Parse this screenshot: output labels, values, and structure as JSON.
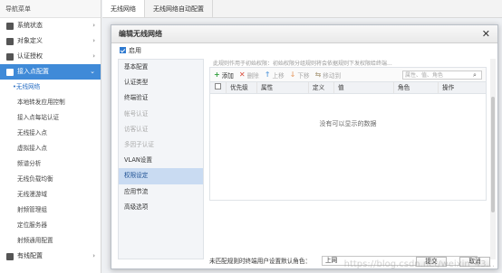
{
  "nav": {
    "title": "导航菜单",
    "groups_top": [
      {
        "label": "系统状态"
      },
      {
        "label": "对象定义"
      },
      {
        "label": "认证授权"
      }
    ],
    "active_group": {
      "label": "接入点配置"
    },
    "sub_items": [
      {
        "label": "•无线网络"
      },
      {
        "label": "本地转发应用控制"
      },
      {
        "label": "接入点每站认证"
      },
      {
        "label": "无线接入点"
      },
      {
        "label": "虚拟接入点"
      },
      {
        "label": "频谱分析"
      },
      {
        "label": "无线负载均衡"
      },
      {
        "label": "无线漫游域"
      },
      {
        "label": "射频管理组"
      },
      {
        "label": "定位服务器"
      },
      {
        "label": "射频通用配置"
      }
    ],
    "bottom_group": {
      "label": "有线配置"
    }
  },
  "tabs": [
    {
      "label": "无线网络"
    },
    {
      "label": "无线网络自动配置"
    }
  ],
  "dialog": {
    "title": "编辑无线网络",
    "close_glyph": "✕",
    "enable_label": "启用",
    "side_items": [
      {
        "label": "基本配置",
        "state": "normal"
      },
      {
        "label": "认证类型",
        "state": "normal"
      },
      {
        "label": "终端验证",
        "state": "normal"
      },
      {
        "label": "帐号认证",
        "state": "disabled"
      },
      {
        "label": "访客认证",
        "state": "disabled"
      },
      {
        "label": "多因子认证",
        "state": "disabled"
      },
      {
        "label": "VLAN设置",
        "state": "normal"
      },
      {
        "label": "权限设定",
        "state": "current"
      },
      {
        "label": "应用节流",
        "state": "normal"
      },
      {
        "label": "高级选项",
        "state": "normal"
      }
    ],
    "hint": "此规则作用于初始权限：初始权限分组规则将会依据规则下发权限给终端...",
    "toolbar": {
      "add": "添加",
      "delete": "删除",
      "up": "上移",
      "down": "下移",
      "move": "移动到",
      "search_placeholder": "属性、值、角色"
    },
    "columns": [
      "优先级",
      "属性",
      "定义",
      "值",
      "角色",
      "操作"
    ],
    "empty_text": "没有可以显示的数据",
    "role_label": "未匹配规则时终端用户设置默认角色：",
    "role_value": "上网",
    "ok_label": "提交",
    "cancel_label": "取消"
  },
  "watermark": "https://blog.csdn.net/weixin_43..."
}
